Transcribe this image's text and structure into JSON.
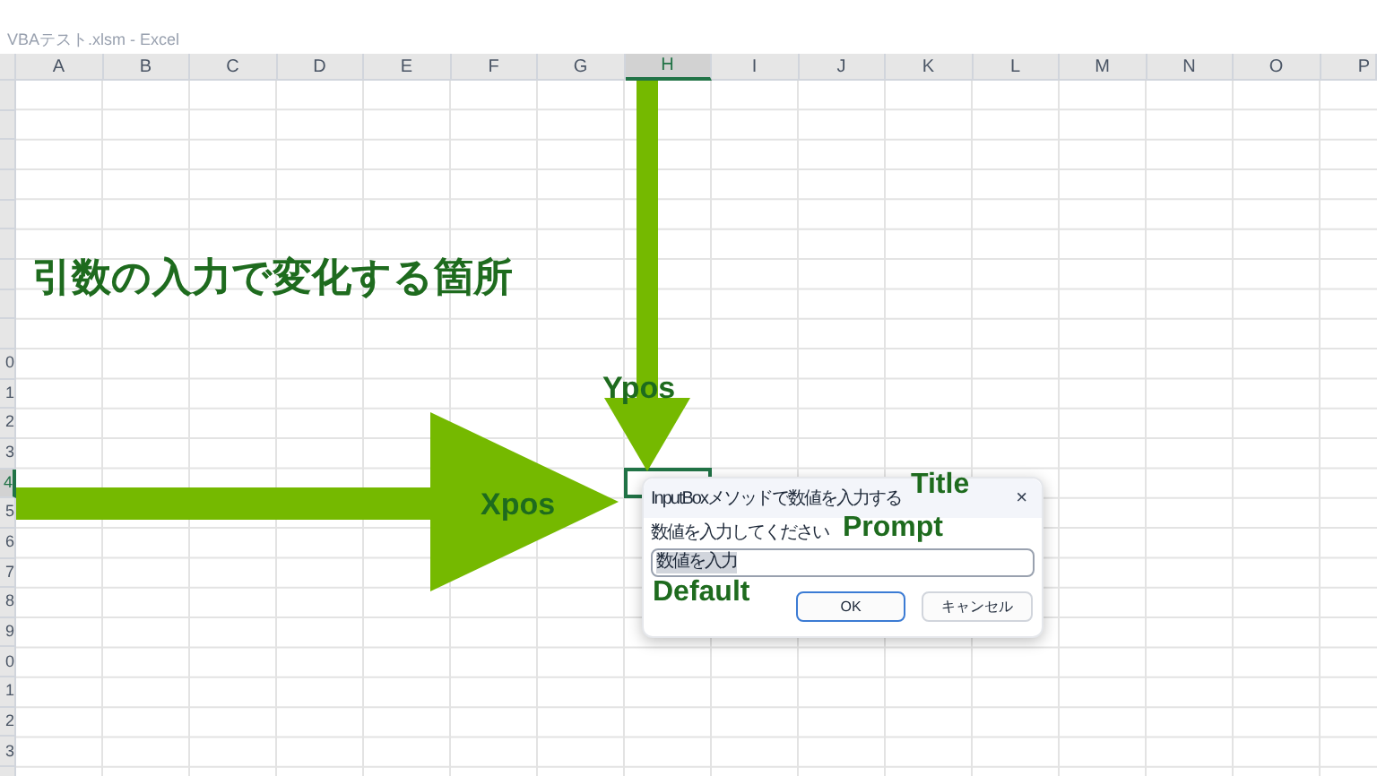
{
  "window": {
    "title": "VBAテスト.xlsm - Excel"
  },
  "columns": [
    {
      "label": "A",
      "selected": false
    },
    {
      "label": "B",
      "selected": false
    },
    {
      "label": "C",
      "selected": false
    },
    {
      "label": "D",
      "selected": false
    },
    {
      "label": "E",
      "selected": false
    },
    {
      "label": "F",
      "selected": false
    },
    {
      "label": "G",
      "selected": false
    },
    {
      "label": "H",
      "selected": true
    },
    {
      "label": "I",
      "selected": false
    },
    {
      "label": "J",
      "selected": false
    },
    {
      "label": "K",
      "selected": false
    },
    {
      "label": "L",
      "selected": false
    },
    {
      "label": "M",
      "selected": false
    },
    {
      "label": "N",
      "selected": false
    },
    {
      "label": "O",
      "selected": false
    },
    {
      "label": "P",
      "selected": false
    }
  ],
  "rows": [
    {
      "label": "0",
      "selected": false
    },
    {
      "label": "1",
      "selected": false
    },
    {
      "label": "2",
      "selected": false
    },
    {
      "label": "3",
      "selected": false
    },
    {
      "label": "4",
      "selected": true
    },
    {
      "label": "5",
      "selected": false
    },
    {
      "label": "6",
      "selected": false
    },
    {
      "label": "7",
      "selected": false
    },
    {
      "label": "8",
      "selected": false
    },
    {
      "label": "9",
      "selected": false
    },
    {
      "label": "0",
      "selected": false
    },
    {
      "label": "1",
      "selected": false
    },
    {
      "label": "2",
      "selected": false
    },
    {
      "label": "3",
      "selected": false
    }
  ],
  "annotation": "引数の入力で変化する箇所",
  "labels": {
    "ypos": "Ypos",
    "xpos": "Xpos",
    "title": "Title",
    "prompt": "Prompt",
    "default": "Default"
  },
  "dialog": {
    "title": "InputBoxメソッドで数値を入力する",
    "close": "×",
    "prompt": "数値を入力してください",
    "value": "数値を入力",
    "buttons": [
      {
        "label": "OK",
        "kind": "default"
      },
      {
        "label": "キャンセル",
        "kind": "normal"
      }
    ]
  }
}
